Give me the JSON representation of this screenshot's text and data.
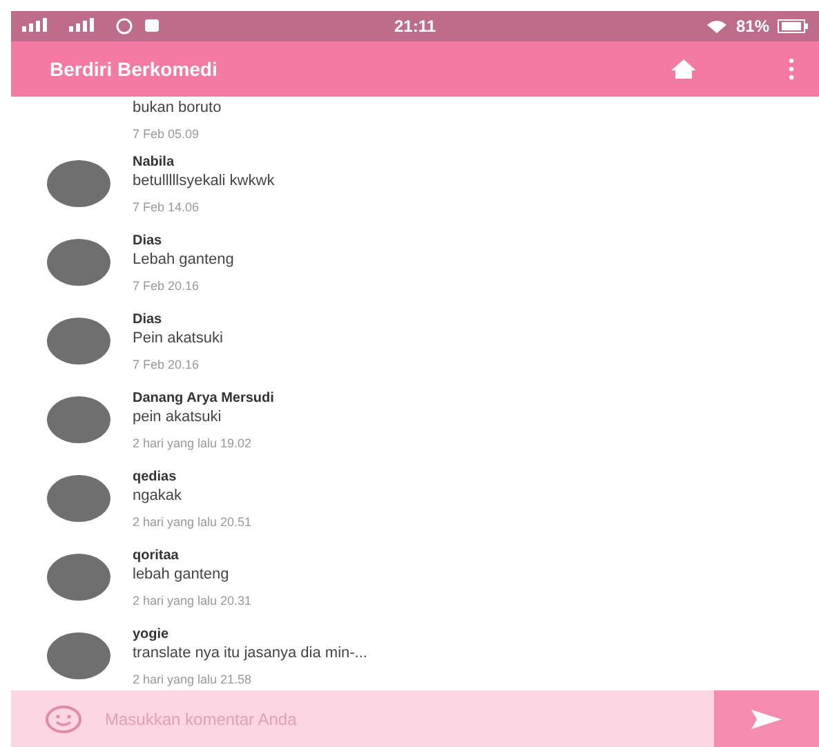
{
  "status_bar": {
    "time": "21:11",
    "battery": "81%"
  },
  "app_bar": {
    "title": "Berdiri Berkomedi"
  },
  "comments": [
    {
      "text": "bukan boruto",
      "time": "7 Feb 05.09",
      "partial": true
    },
    {
      "name": "Nabila",
      "text": "betulllllsyekali kwkwk",
      "time": "7 Feb 14.06",
      "partial": false
    },
    {
      "name": "Dias",
      "text": "Lebah ganteng",
      "time": "7 Feb 20.16",
      "partial": false
    },
    {
      "name": "Dias",
      "text": "Pein akatsuki",
      "time": "7 Feb 20.16",
      "partial": false
    },
    {
      "name": "Danang Arya Mersudi",
      "text": "pein akatsuki",
      "time": "2 hari yang lalu 19.02",
      "partial": false
    },
    {
      "name": "qedias",
      "text": "ngakak",
      "time": "2 hari yang lalu 20.51",
      "partial": false
    },
    {
      "name": "qoritaa",
      "text": "lebah ganteng",
      "time": "2 hari yang lalu 20.31",
      "partial": false
    },
    {
      "name": "yogie",
      "text": "translate nya itu jasanya dia min-...",
      "time": "2 hari yang lalu 21.58",
      "partial": false
    }
  ],
  "comment_input": {
    "placeholder": "Masukkan komentar Anda"
  }
}
